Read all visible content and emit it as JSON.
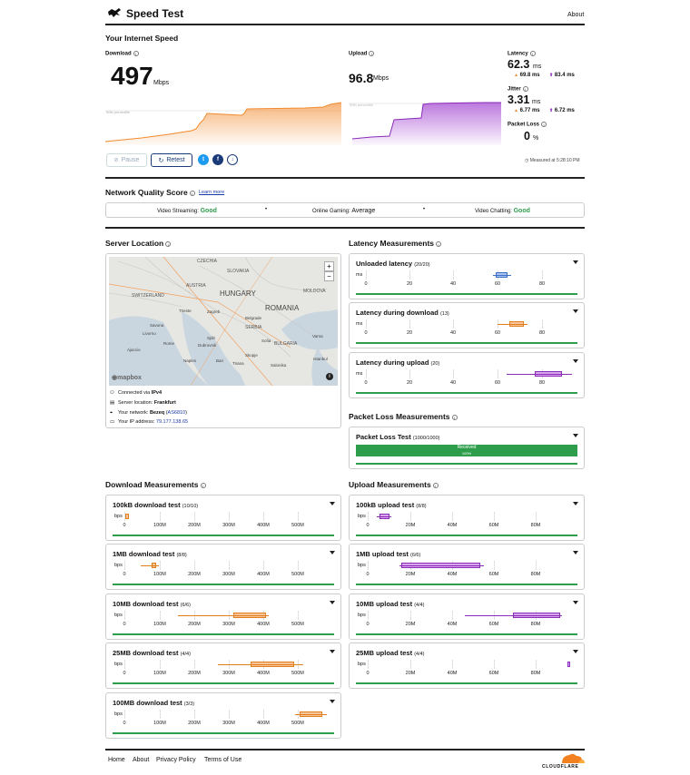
{
  "header": {
    "title": "Speed Test",
    "about": "About"
  },
  "speed": {
    "section_title": "Your Internet Speed",
    "download": {
      "label": "Download",
      "value": "497",
      "unit": "Mbps",
      "percentile": "90th percentile"
    },
    "upload": {
      "label": "Upload",
      "value": "96.8",
      "unit": "Mbps",
      "percentile": "90th percentile"
    },
    "latency": {
      "label": "Latency",
      "value": "62.3",
      "unit": "ms",
      "down": "69.8 ms",
      "up": "83.4 ms"
    },
    "jitter": {
      "label": "Jitter",
      "value": "3.31",
      "unit": "ms",
      "down": "6.77 ms",
      "up": "6.72 ms"
    },
    "loss": {
      "label": "Packet Loss",
      "value": "0",
      "unit": "%"
    },
    "pause": "Pause",
    "retest": "Retest",
    "measured": "Measured at 5:28:10 PM"
  },
  "nqs": {
    "title": "Network Quality Score",
    "learn": "Learn more",
    "streaming_label": "Video Streaming:",
    "streaming_value": "Good",
    "gaming_label": "Online Gaming:",
    "gaming_value": "Average",
    "chatting_label": "Video Chatting:",
    "chatting_value": "Good"
  },
  "server": {
    "title": "Server Location",
    "map": {
      "countries": [
        "CZECHIA",
        "SLOVAKIA",
        "AUSTRIA",
        "HUNGARY",
        "MOLDOVA",
        "SWITZERLAND",
        "ROMANIA",
        "SERBIA",
        "BULGARIA"
      ],
      "cities": [
        "Trieste",
        "Zagreb",
        "Belgrade",
        "Savona",
        "Livorno",
        "Rome",
        "Split",
        "Dubrovnik",
        "Sofia",
        "Varna",
        "Naples",
        "Ajaccio",
        "Bari",
        "Skopje",
        "Istanbul",
        "Salonika",
        "Tirana"
      ],
      "logo": "mapbox",
      "zoom_in": "+",
      "zoom_out": "−"
    },
    "lines": [
      {
        "label": "Connected via ",
        "value": "IPv4"
      },
      {
        "label": "Server location: ",
        "value": "Frankfurt"
      },
      {
        "label": "Your network: ",
        "value": "Bezeq",
        "link": "AS6810"
      },
      {
        "label": "Your IP address: ",
        "link": "79.177.138.65"
      }
    ]
  },
  "latency_section": {
    "title": "Latency Measurements",
    "cards": [
      {
        "title": "Unloaded latency",
        "count": "(20/20)",
        "unit": "ms",
        "ticks": [
          "0",
          "20",
          "40",
          "60",
          "80"
        ]
      },
      {
        "title": "Latency during download",
        "count": "(13)",
        "unit": "ms",
        "ticks": [
          "0",
          "20",
          "40",
          "60",
          "80"
        ]
      },
      {
        "title": "Latency during upload",
        "count": "(20)",
        "unit": "ms",
        "ticks": [
          "0",
          "20",
          "40",
          "60",
          "80"
        ]
      }
    ]
  },
  "loss_section": {
    "title": "Packet Loss Measurements",
    "card_title": "Packet Loss Test",
    "count": "(1000/1000)",
    "received": "Received",
    "pct": "100%"
  },
  "download_section": {
    "title": "Download Measurements",
    "cards": [
      {
        "title": "100kB download test",
        "count": "(10/10)",
        "unit": "bps",
        "ticks": [
          "0",
          "100M",
          "200M",
          "300M",
          "400M",
          "500M"
        ]
      },
      {
        "title": "1MB download test",
        "count": "(8/8)",
        "unit": "bps",
        "ticks": [
          "0",
          "100M",
          "200M",
          "300M",
          "400M",
          "500M"
        ]
      },
      {
        "title": "10MB download test",
        "count": "(6/6)",
        "unit": "bps",
        "ticks": [
          "0",
          "100M",
          "200M",
          "300M",
          "400M",
          "500M"
        ]
      },
      {
        "title": "25MB download test",
        "count": "(4/4)",
        "unit": "bps",
        "ticks": [
          "0",
          "100M",
          "200M",
          "300M",
          "400M",
          "500M"
        ]
      },
      {
        "title": "100MB download test",
        "count": "(3/3)",
        "unit": "bps",
        "ticks": [
          "0",
          "100M",
          "200M",
          "300M",
          "400M",
          "500M"
        ]
      }
    ]
  },
  "upload_section": {
    "title": "Upload Measurements",
    "cards": [
      {
        "title": "100kB upload test",
        "count": "(8/8)",
        "unit": "bps",
        "ticks": [
          "0",
          "20M",
          "40M",
          "60M",
          "80M"
        ]
      },
      {
        "title": "1MB upload test",
        "count": "(6/6)",
        "unit": "bps",
        "ticks": [
          "0",
          "20M",
          "40M",
          "60M",
          "80M"
        ]
      },
      {
        "title": "10MB upload test",
        "count": "(4/4)",
        "unit": "bps",
        "ticks": [
          "0",
          "20M",
          "40M",
          "60M",
          "80M"
        ]
      },
      {
        "title": "25MB upload test",
        "count": "(4/4)",
        "unit": "bps",
        "ticks": [
          "0",
          "20M",
          "40M",
          "60M",
          "80M"
        ]
      }
    ]
  },
  "footer": {
    "links": [
      "Home",
      "About",
      "Privacy Policy",
      "Terms of Use"
    ],
    "brand": "CLOUDFLARE"
  },
  "colors": {
    "download": "#f5a25a",
    "upload": "#b060d8",
    "latency": "#4f86d8",
    "good": "#2e9e4c",
    "cf_orange": "#f48120"
  }
}
